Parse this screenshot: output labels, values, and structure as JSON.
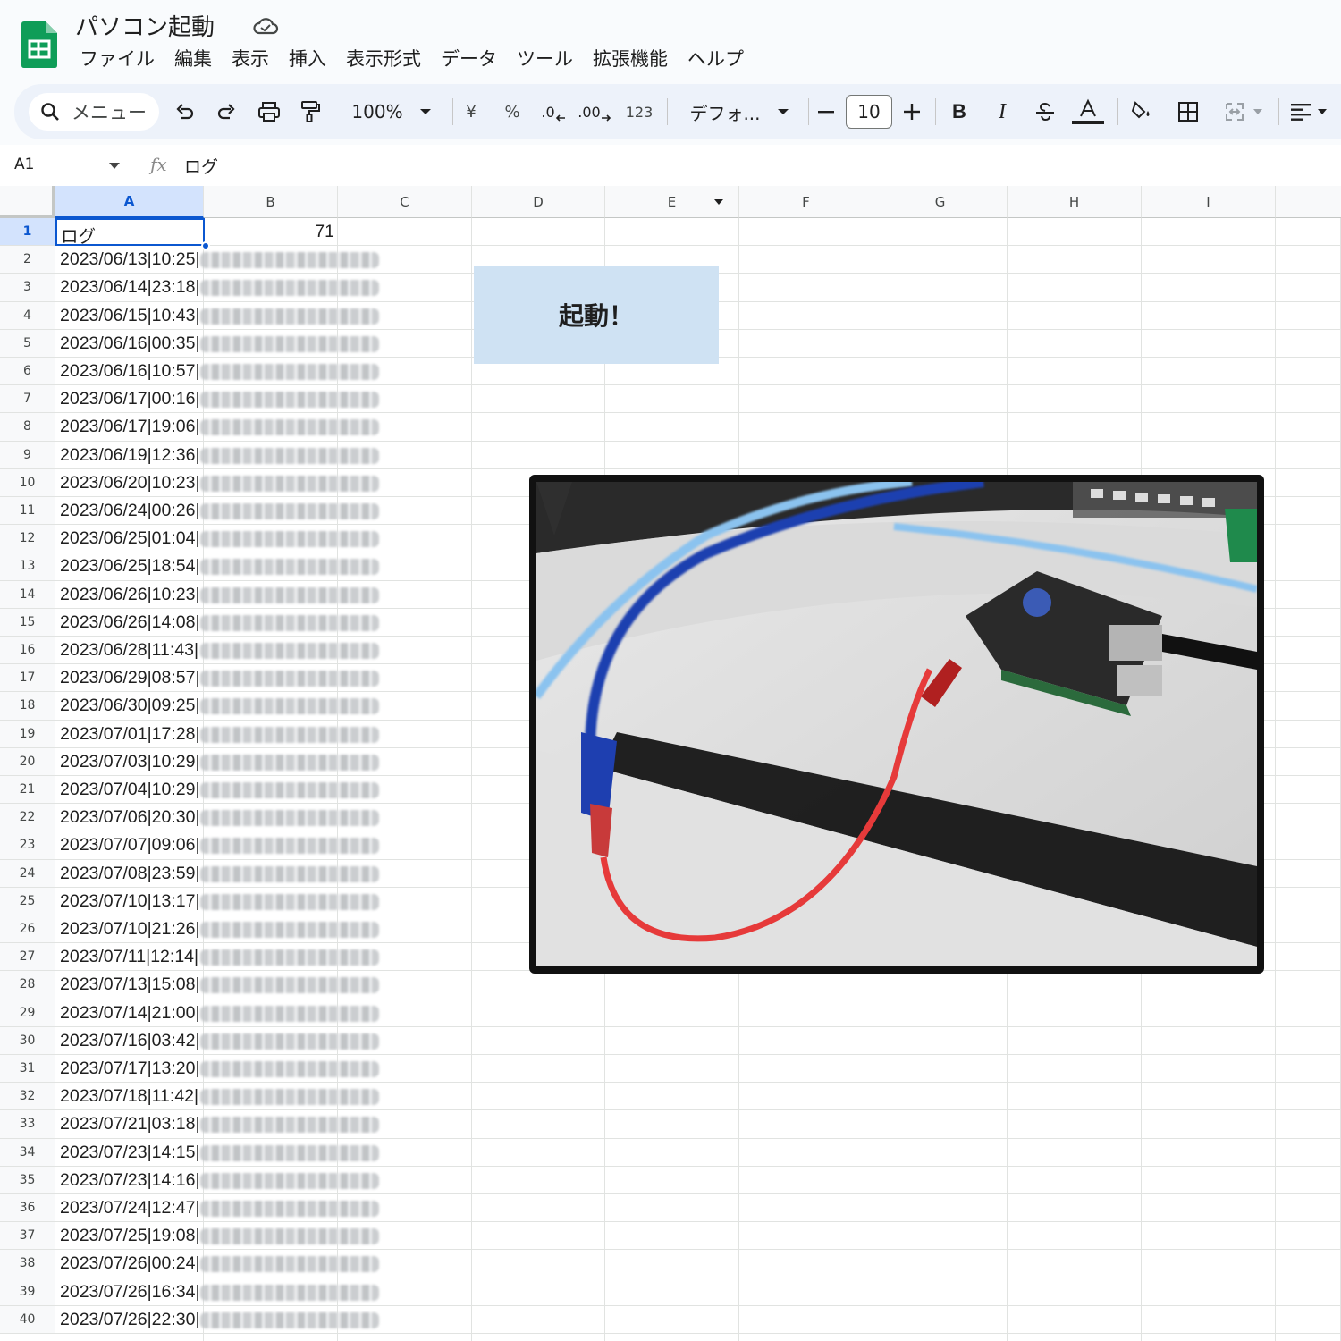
{
  "doc": {
    "title": "パソコン起動",
    "menu": [
      "ファイル",
      "編集",
      "表示",
      "挿入",
      "表示形式",
      "データ",
      "ツール",
      "拡張機能",
      "ヘルプ"
    ]
  },
  "toolbar": {
    "menu_search": "メニュー",
    "zoom": "100%",
    "currency": "¥",
    "percent": "%",
    "dec_decrease": ".0",
    "dec_increase": ".00",
    "number_format": "123",
    "font": "デフォ...",
    "font_size": "10",
    "bold": "B",
    "italic": "I"
  },
  "formula_bar": {
    "cell_ref": "A1",
    "fx": "fx",
    "content": "ログ"
  },
  "columns": [
    "A",
    "B",
    "C",
    "D",
    "E",
    "F",
    "G",
    "H",
    "I"
  ],
  "cells": {
    "A1": "ログ",
    "B1": "71"
  },
  "log_rows": [
    "2023/06/13|10:25|",
    "2023/06/14|23:18|",
    "2023/06/15|10:43|",
    "2023/06/16|00:35|",
    "2023/06/16|10:57|",
    "2023/06/17|00:16|",
    "2023/06/17|19:06|",
    "2023/06/19|12:36|",
    "2023/06/20|10:23|",
    "2023/06/24|00:26|",
    "2023/06/25|01:04|",
    "2023/06/25|18:54|",
    "2023/06/26|10:23|",
    "2023/06/26|14:08|",
    "2023/06/28|11:43|",
    "2023/06/29|08:57|",
    "2023/06/30|09:25|",
    "2023/07/01|17:28|",
    "2023/07/03|10:29|",
    "2023/07/04|10:29|",
    "2023/07/06|20:30|",
    "2023/07/07|09:06|",
    "2023/07/08|23:59|",
    "2023/07/10|13:17|",
    "2023/07/10|21:26|",
    "2023/07/11|12:14|",
    "2023/07/13|15:08|",
    "2023/07/14|21:00|",
    "2023/07/16|03:42|",
    "2023/07/17|13:20|",
    "2023/07/18|11:42|",
    "2023/07/21|03:18|",
    "2023/07/23|14:15|",
    "2023/07/23|14:16|",
    "2023/07/24|12:47|",
    "2023/07/25|19:08|",
    "2023/07/26|00:24|",
    "2023/07/26|16:34|",
    "2023/07/26|22:30|"
  ],
  "drawing_button": {
    "label": "起動！"
  },
  "colors": {
    "accent": "#0b57d0",
    "button_bg": "#cfe2f3",
    "sheets_green": "#0f9d58"
  }
}
